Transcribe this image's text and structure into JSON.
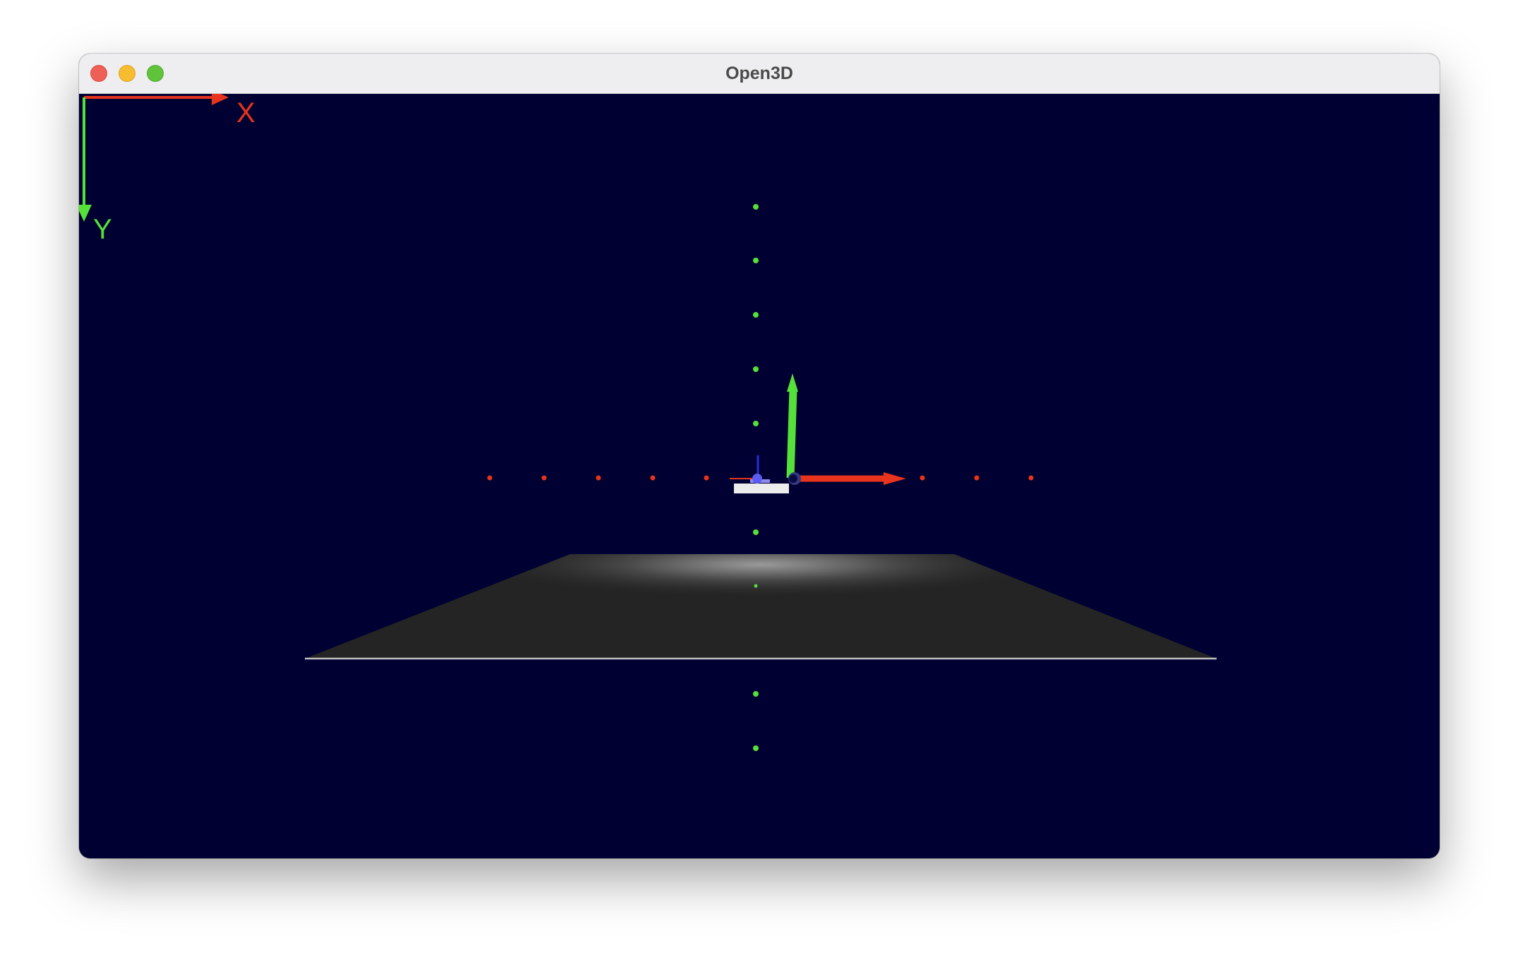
{
  "window": {
    "title": "Open3D"
  },
  "colors": {
    "background": "#000033",
    "x_axis": "#e8341c",
    "y_axis": "#55e03a",
    "z_axis": "#2b2bd6",
    "floor": "#242424",
    "titlebar": "#eeeef0"
  },
  "overlay_axes": {
    "x_label": "X",
    "y_label": "Y"
  },
  "icons": {
    "close": "close-button",
    "minimize": "minimize-button",
    "maximize": "maximize-button"
  }
}
